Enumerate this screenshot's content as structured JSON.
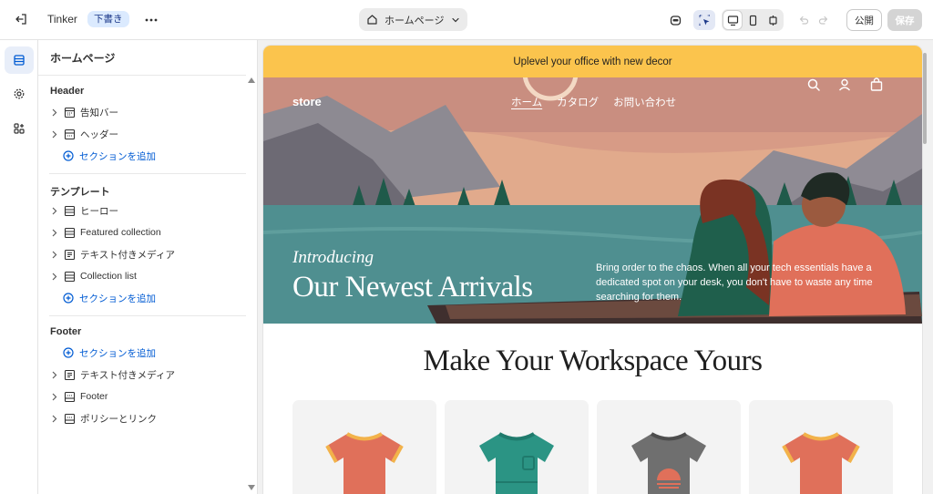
{
  "topbar": {
    "store_name": "Tinker",
    "status_badge": "下書き",
    "page_select": "ホームページ",
    "publish_label": "公開",
    "save_label": "保存"
  },
  "sidebar": {
    "title": "ホームページ",
    "groups": [
      {
        "label": "Header",
        "items": [
          {
            "label": "告知バー",
            "icon": "announcement-icon",
            "expand": "chevron-right-icon"
          },
          {
            "label": "ヘッダー",
            "icon": "header-layout-icon",
            "expand": "chevron-right-icon"
          }
        ],
        "add_label": "セクションを追加"
      },
      {
        "label": "テンプレート",
        "items": [
          {
            "label": "ヒーロー",
            "icon": "section-icon",
            "expand": "chevron-right-icon"
          },
          {
            "label": "Featured collection",
            "icon": "section-icon",
            "expand": "chevron-right-icon"
          },
          {
            "label": "テキスト付きメディア",
            "icon": "text-media-icon",
            "expand": "chevron-right-icon"
          },
          {
            "label": "Collection list",
            "icon": "section-icon",
            "expand": "chevron-right-icon"
          }
        ],
        "add_label": "セクションを追加"
      },
      {
        "label": "Footer",
        "add_label": "セクションを追加",
        "items": [
          {
            "label": "テキスト付きメディア",
            "icon": "text-media-icon",
            "expand": "chevron-right-icon"
          },
          {
            "label": "Footer",
            "icon": "footer-layout-icon",
            "expand": "chevron-right-icon"
          },
          {
            "label": "ポリシーとリンク",
            "icon": "footer-layout-icon",
            "expand": "chevron-right-icon"
          }
        ]
      }
    ]
  },
  "preview": {
    "announcement": "Uplevel your office with new decor",
    "logo": "store",
    "nav_links": [
      "ホーム",
      "カタログ",
      "お問い合わせ"
    ],
    "hero_kicker": "Introducing",
    "hero_title": "Our Newest Arrivals",
    "hero_copy": "Bring order to the chaos. When all your tech essentials have a dedicated spot on your desk, you don't have to waste any time searching for them.",
    "featured_title": "Make Your Workspace Yours",
    "products": [
      {
        "name": "coral-tshirt",
        "color": "#e0705a",
        "trim": "#f2b24a"
      },
      {
        "name": "teal-tshirt",
        "color": "#2b9484",
        "trim": "#1f7a6c"
      },
      {
        "name": "gray-sunset-tshirt",
        "color": "#6f6f6f",
        "trim": "#4d4d4d"
      },
      {
        "name": "coral-tshirt-2",
        "color": "#e0705a",
        "trim": "#f2b24a"
      }
    ]
  },
  "colors": {
    "accent": "#005bd3",
    "announcement_bg": "#fbc44d",
    "badge_bg": "#dbeafe"
  }
}
